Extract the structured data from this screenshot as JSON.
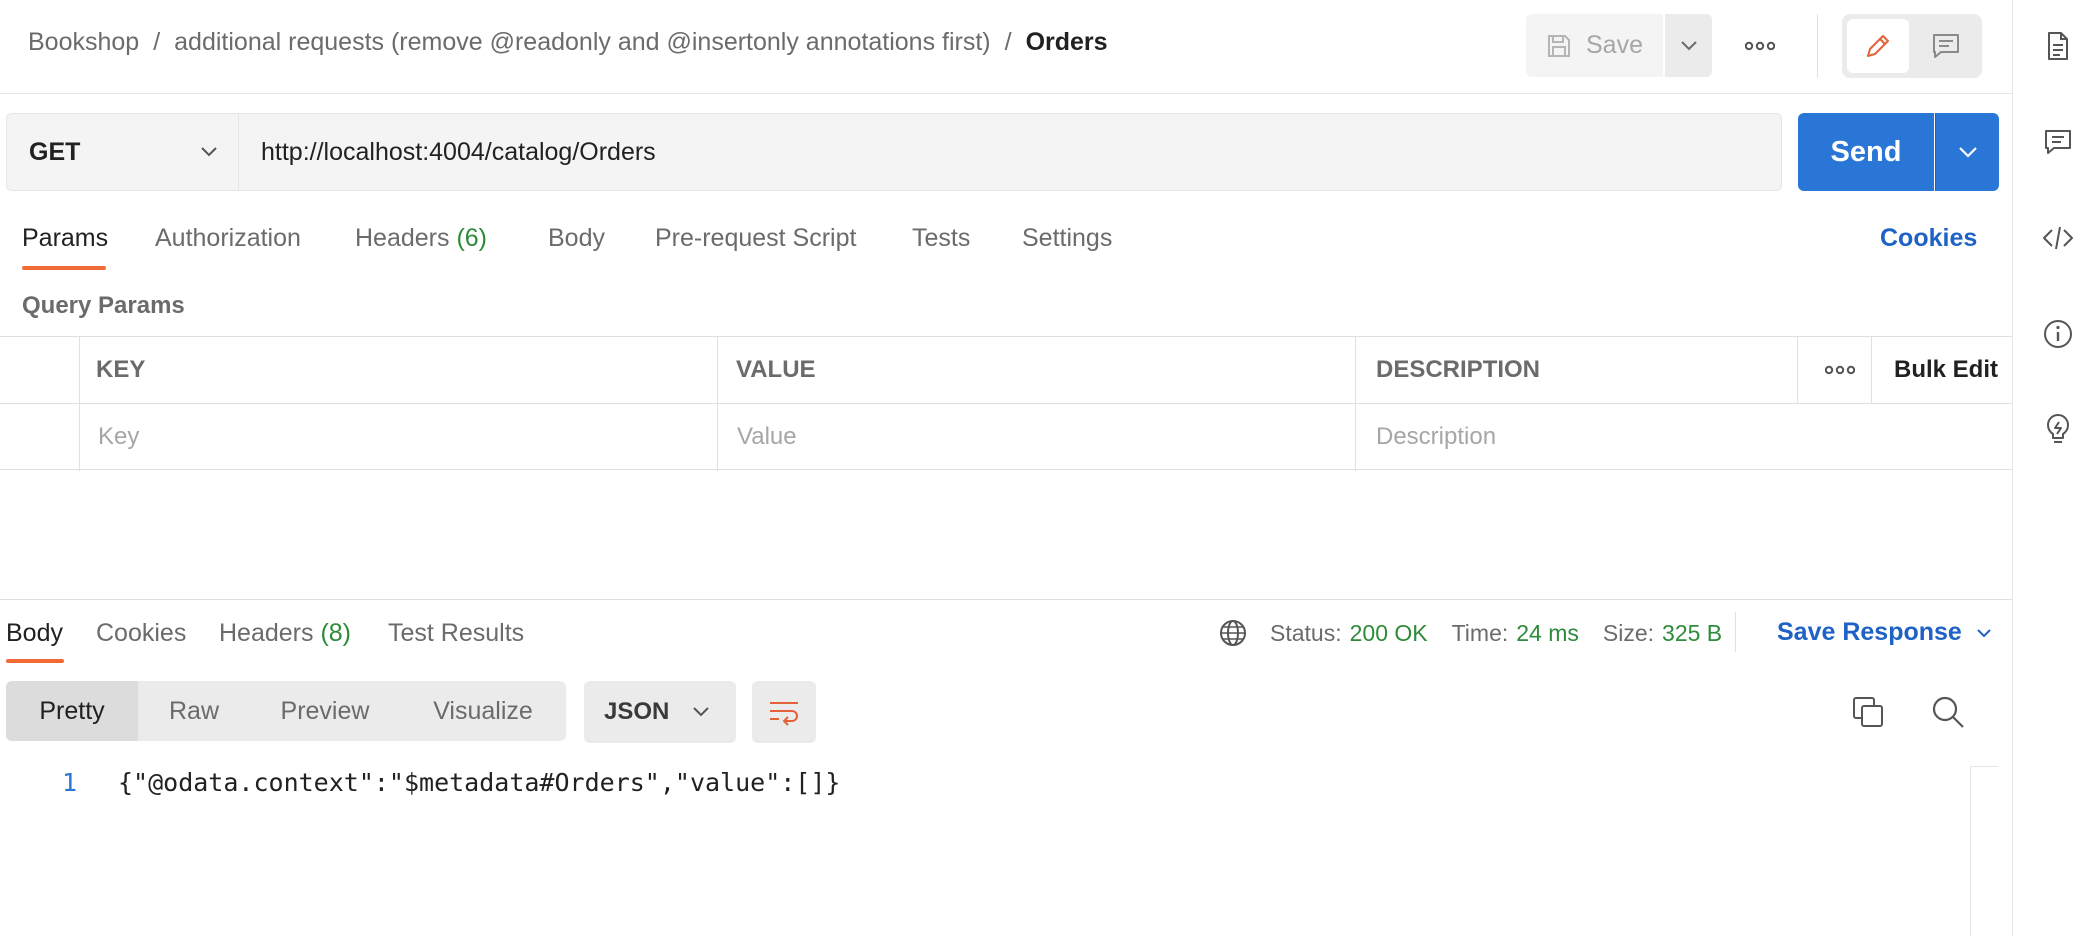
{
  "header": {
    "breadcrumb": [
      "Bookshop",
      "additional requests (remove @readonly and @insertonly annotations first)",
      "Orders"
    ],
    "save_label": "Save"
  },
  "request": {
    "method": "GET",
    "url": "http://localhost:4004/catalog/Orders",
    "send_label": "Send"
  },
  "request_tabs": [
    {
      "label": "Params",
      "count": null
    },
    {
      "label": "Authorization",
      "count": null
    },
    {
      "label": "Headers",
      "count": "(6)"
    },
    {
      "label": "Body",
      "count": null
    },
    {
      "label": "Pre-request Script",
      "count": null
    },
    {
      "label": "Tests",
      "count": null
    },
    {
      "label": "Settings",
      "count": null
    }
  ],
  "cookies_label": "Cookies",
  "query_params": {
    "title": "Query Params",
    "columns": [
      "KEY",
      "VALUE",
      "DESCRIPTION"
    ],
    "bulk_edit_label": "Bulk Edit",
    "placeholders": {
      "key": "Key",
      "value": "Value",
      "description": "Description"
    }
  },
  "response": {
    "tabs": [
      {
        "label": "Body",
        "count": null
      },
      {
        "label": "Cookies",
        "count": null
      },
      {
        "label": "Headers",
        "count": "(8)"
      },
      {
        "label": "Test Results",
        "count": null
      }
    ],
    "status_label": "Status:",
    "status_value": "200 OK",
    "time_label": "Time:",
    "time_value": "24 ms",
    "size_label": "Size:",
    "size_value": "325 B",
    "save_response_label": "Save Response",
    "view_modes": [
      "Pretty",
      "Raw",
      "Preview",
      "Visualize"
    ],
    "format": "JSON",
    "line_number": "1",
    "body_text": "{\"@odata.context\":\"$metadata#Orders\",\"value\":[]}"
  },
  "colors": {
    "accent_orange": "#f06a35",
    "primary_blue": "#2a76d6",
    "link_blue": "#1f62c6",
    "success_green": "#2e8b3a"
  },
  "icons": {
    "save": "floppy-disk-icon",
    "more": "more-horizontal-icon",
    "edit": "pencil-icon",
    "comment": "comment-icon",
    "sidebar": [
      "document-icon",
      "comments-icon",
      "code-icon",
      "info-icon",
      "lightbulb-icon"
    ],
    "globe": "globe-icon",
    "wrap": "text-wrap-icon",
    "copy": "copy-icon",
    "search": "search-icon"
  }
}
